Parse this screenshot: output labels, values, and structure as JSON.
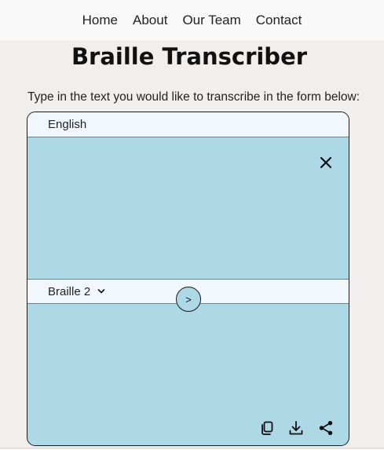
{
  "nav": {
    "items": [
      {
        "label": "Home"
      },
      {
        "label": "About"
      },
      {
        "label": "Our Team"
      },
      {
        "label": "Contact"
      }
    ]
  },
  "page": {
    "title": "Braille Transcriber",
    "instructions": "Type in the text you would like to transcribe in the form below:"
  },
  "transcriber": {
    "source_language": "English",
    "target_language": "Braille 2",
    "input_value": "",
    "output_value": "",
    "convert_label": ">",
    "icons": {
      "clear": "close-icon",
      "copy": "copy-icon",
      "download": "download-icon",
      "share": "share-icon",
      "dropdown": "chevron-down-icon"
    }
  }
}
